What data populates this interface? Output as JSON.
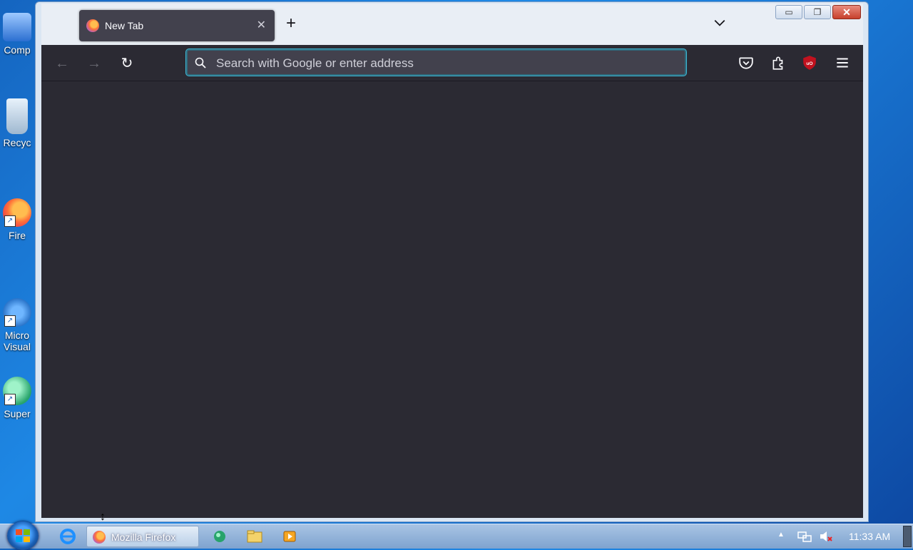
{
  "desktop": {
    "icons": [
      {
        "label": "Comp",
        "icon": "computer-icon"
      },
      {
        "label": "Recyc",
        "icon": "recycle-bin-icon"
      },
      {
        "label": "Fire",
        "icon": "firefox-icon"
      },
      {
        "label": "Micro",
        "label2": "Visual",
        "icon": "visual-studio-icon"
      },
      {
        "label": "Super",
        "icon": "app-icon"
      }
    ]
  },
  "browser": {
    "tab": {
      "title": "New Tab",
      "close_glyph": "✕"
    },
    "new_tab_glyph": "+",
    "window_controls": {
      "minimize": "▭",
      "maximize": "❐",
      "close": "✕"
    },
    "nav": {
      "back": "←",
      "forward": "→",
      "reload": "↻"
    },
    "urlbar": {
      "placeholder": "Search with Google or enter address",
      "value": ""
    },
    "toolbar_icons": [
      "pocket-icon",
      "extensions-icon",
      "ublock-icon",
      "menu-icon"
    ]
  },
  "taskbar": {
    "firefox_label": "Mozilla Firefox",
    "clock": "11:33 AM",
    "tray_up_glyph": "▲"
  },
  "colors": {
    "toolbar_bg": "#2b2a33",
    "tab_bg": "#42414d",
    "accent": "#3fb8d6",
    "ublock_red": "#c1121f"
  }
}
